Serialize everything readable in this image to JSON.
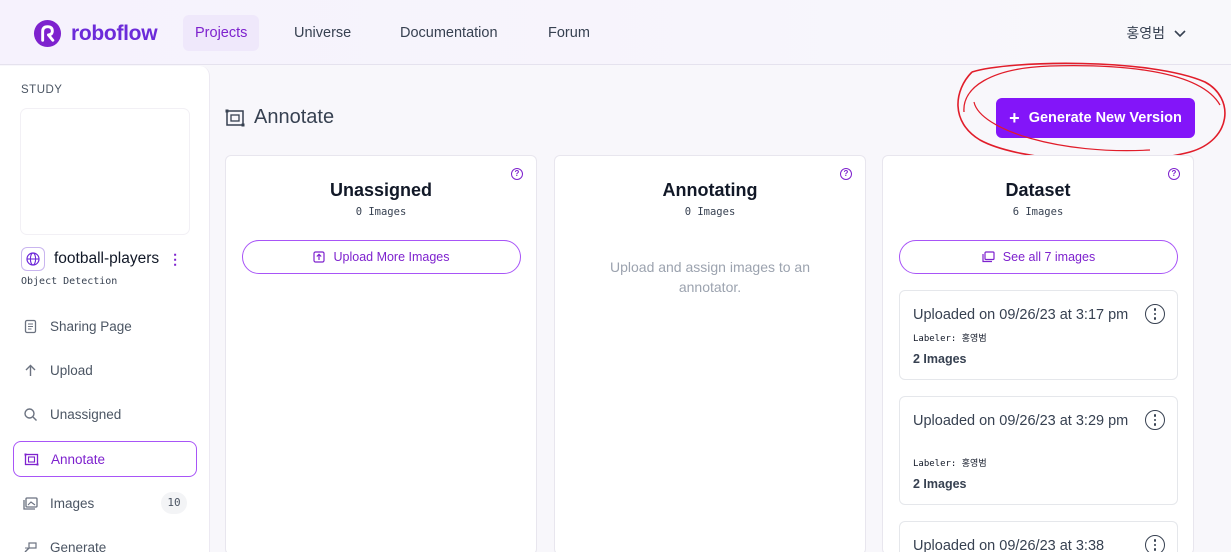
{
  "brand": {
    "name": "roboflow",
    "color": "#7e22ce"
  },
  "nav": {
    "items": [
      {
        "label": "Projects",
        "active": true
      },
      {
        "label": "Universe",
        "active": false
      },
      {
        "label": "Documentation",
        "active": false
      },
      {
        "label": "Forum",
        "active": false
      }
    ],
    "user": "홍영범"
  },
  "sidebar": {
    "workspace_label": "STUDY",
    "project": {
      "name": "football-players",
      "type": "Object Detection"
    },
    "items": [
      {
        "label": "Sharing Page",
        "icon": "document-icon"
      },
      {
        "label": "Upload",
        "icon": "arrow-up-icon"
      },
      {
        "label": "Unassigned",
        "icon": "search-icon"
      },
      {
        "label": "Annotate",
        "icon": "annotate-icon",
        "active": true
      },
      {
        "label": "Images",
        "icon": "images-icon",
        "badge": "10"
      },
      {
        "label": "Generate",
        "icon": "generate-icon"
      }
    ]
  },
  "main": {
    "title": "Annotate",
    "generate_button": "Generate New Version",
    "columns": [
      {
        "title": "Unassigned",
        "count": "0 Images",
        "button": "Upload More Images"
      },
      {
        "title": "Annotating",
        "count": "0 Images",
        "empty_text": "Upload and assign images to an annotator."
      },
      {
        "title": "Dataset",
        "count": "6 Images",
        "button": "See all 7 images",
        "batches": [
          {
            "title": "Uploaded on 09/26/23 at 3:17 pm",
            "labeler": "Labeler: 홍영범",
            "images": "2 Images"
          },
          {
            "title": "Uploaded on 09/26/23 at 3:29 pm",
            "labeler": "Labeler: 홍영범",
            "images": "2 Images"
          },
          {
            "title": "Uploaded on 09/26/23 at 3:38"
          }
        ]
      }
    ]
  },
  "colors": {
    "accent": "#8315f9",
    "annotation_circle": "#e11d2a"
  }
}
